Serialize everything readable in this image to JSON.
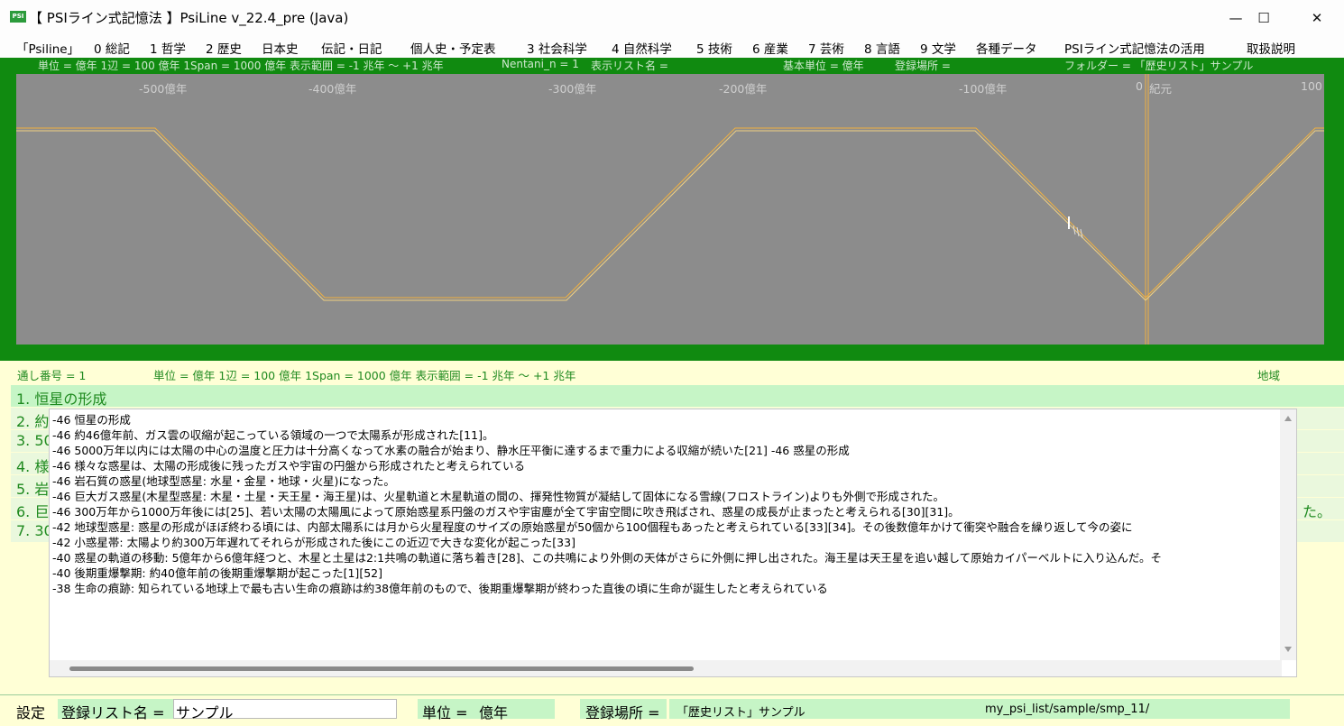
{
  "window": {
    "title": "【 PSIライン式記憶法 】PsiLine v_22.4_pre (Java)",
    "icon_text": "PSI",
    "minimize": "—",
    "maximize": "☐",
    "close": "✕"
  },
  "menu": [
    "「Psiline」",
    "0 総記",
    "1 哲学",
    "2 歴史",
    "日本史",
    "伝記・日記",
    "個人史・予定表",
    "3 社会科学",
    "4 自然科学",
    "5 技術",
    "6 産業",
    "7 芸術",
    "8 言語",
    "9 文学",
    "各種データ",
    "PSIライン式記憶法の活用",
    "取扱説明"
  ],
  "info_bar": {
    "scale": "単位 = 億年  1辺 = 100 億年  1Span = 1000 億年  表示範囲 = -1 兆年 〜 +1 兆年",
    "nentani": "Nentani_n = 1",
    "list_name": "表示リスト名 =",
    "base_unit": "基本単位 = 億年",
    "location": "登録場所 =",
    "folder": "フォルダー = 「歴史リスト」サンプル"
  },
  "axis_ticks": [
    "-500億年",
    "-400億年",
    "-300億年",
    "-200億年",
    "-100億年",
    "0",
    "紀元",
    "100"
  ],
  "colors": {
    "frame_green": "#108a10",
    "plot_gray": "#8c8c8c",
    "line_orange": "#f0b040"
  },
  "lower_info": {
    "serial": "通し番号 = 1",
    "scale": "単位 = 億年  1辺 = 100 億年  1Span = 1000 億年  表示範囲 = -1 兆年 〜 +1 兆年",
    "region": "地域"
  },
  "list_items": [
    "1. 恒星の形成",
    "2. 約",
    "3. 50",
    "4. 様",
    "5. 岩",
    "6. 巨",
    "7. 30"
  ],
  "list_item_6_tail": "た。",
  "editor_lines": [
    "-46   恒星の形成",
    "-46   約46億年前、ガス雲の収縮が起こっている領域の一つで太陽系が形成された[11]。",
    "-46   5000万年以内には太陽の中心の温度と圧力は十分高くなって水素の融合が始まり、静水圧平衡に達するまで重力による収縮が続いた[21] -46   惑星の形成",
    "-46   様々な惑星は、太陽の形成後に残ったガスや宇宙の円盤から形成されたと考えられている",
    "-46   岩石質の惑星(地球型惑星: 水星・金星・地球・火星)になった。",
    "-46   巨大ガス惑星(木星型惑星: 木星・土星・天王星・海王星)は、火星軌道と木星軌道の間の、揮発性物質が凝結して固体になる雪線(フロストライン)よりも外側で形成された。",
    "-46   300万年から1000万年後には[25]、若い太陽の太陽風によって原始惑星系円盤のガスや宇宙塵が全て宇宙空間に吹き飛ばされ、惑星の成長が止まったと考えられる[30][31]。",
    "-42   地球型惑星: 惑星の形成がほぼ終わる頃には、内部太陽系には月から火星程度のサイズの原始惑星が50個から100個程もあったと考えられている[33][34]。その後数億年かけて衝突や融合を繰り返して今の姿に",
    "-42   小惑星帯: 太陽より約300万年遅れてそれらが形成された後にこの近辺で大きな変化が起こった[33]",
    "-40   惑星の軌道の移動: 5億年から6億年経つと、木星と土星は2:1共鳴の軌道に落ち着き[28]、この共鳴により外側の天体がさらに外側に押し出された。海王星は天王星を追い越して原始カイパーベルトに入り込んだ。そ",
    "-40   後期重爆撃期: 約40億年前の後期重爆撃期が起こった[1][52]",
    "-38   生命の痕跡: 知られている地球上で最も古い生命の痕跡は約38億年前のもので、後期重爆撃期が終わった直後の頃に生命が誕生したと考えられている"
  ],
  "status": {
    "settings": "設定",
    "list_name_label": "登録リスト名 =",
    "list_name_value": "サンプル",
    "unit_label": "単位 =",
    "unit_value": "億年",
    "location_label": "登録場所 =",
    "location_value": "「歴史リスト」サンプル",
    "path": "my_psi_list/sample/smp_11/"
  }
}
